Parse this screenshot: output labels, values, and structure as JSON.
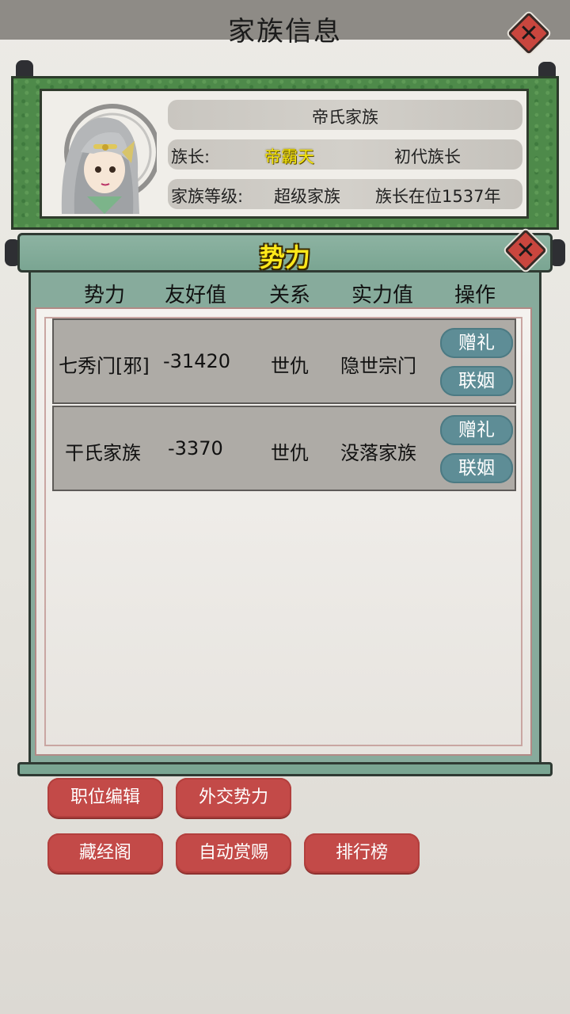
{
  "header": {
    "title": "家族信息"
  },
  "family": {
    "name": "帝氏家族",
    "leader_label": "族长:",
    "leader_name": "帝霸天",
    "leader_generation": "初代族长",
    "level_label": "家族等级:",
    "level_value": "超级家族",
    "tenure": "族长在位1537年"
  },
  "factions_panel": {
    "title": "势力",
    "columns": [
      "势力",
      "友好值",
      "关系",
      "实力值",
      "操作"
    ],
    "rows": [
      {
        "name": "七秀门[邪]",
        "friendliness": "-31420",
        "relation": "世仇",
        "strength": "隐世宗门",
        "gift_label": "赠礼",
        "marriage_label": "联姻"
      },
      {
        "name": "干氏家族",
        "friendliness": "-3370",
        "relation": "世仇",
        "strength": "没落家族",
        "gift_label": "赠礼",
        "marriage_label": "联姻"
      }
    ]
  },
  "bottom_buttons": [
    "职位编辑",
    "外交势力",
    "藏经阁",
    "自动赏赐",
    "排行榜"
  ],
  "icons": {
    "close": "close-icon",
    "portrait": "leader-portrait"
  },
  "colors": {
    "gold_text": "#f5e40a",
    "scroll_green": "#4e8a4a",
    "panel_teal": "#87ab9c",
    "button_red": "#c34a48",
    "pill_teal": "#5e8d96"
  }
}
